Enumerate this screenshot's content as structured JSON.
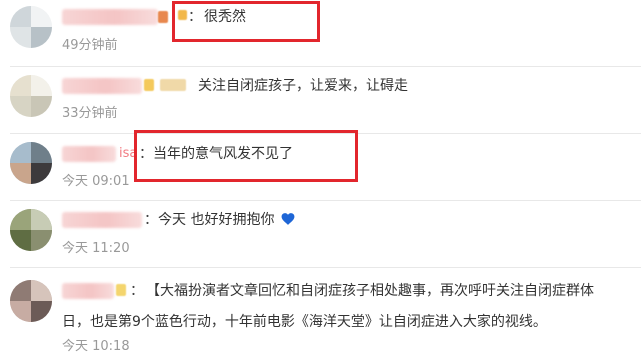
{
  "comments": [
    {
      "name_fragment": "",
      "text": "很秃然",
      "time": "49分钟前"
    },
    {
      "name_fragment": "",
      "text": "关注自闭症孩子，让爱来，让碍走",
      "time": "33分钟前"
    },
    {
      "name_fragment": "isa",
      "text": "当年的意气风发不见了",
      "time": "今天 09:01"
    },
    {
      "name_fragment": "",
      "text": "今天 也好好拥抱你",
      "emoji": "blue-heart-icon",
      "time": "今天 11:20"
    },
    {
      "name_fragment": "",
      "text_line1": "【大福扮演者文章回忆和自闭症孩子相处趣事，再次呼吁关注自闭症群体",
      "text_line2": "日，也是第9个蓝色行动，十年前电影《海洋天堂》让自闭症进入大家的视线。",
      "time": "今天 10:18"
    }
  ],
  "separator": "：",
  "colors": {
    "highlight": "#e2262d",
    "name_pink": "#f17b82",
    "heart": "#1e66d6",
    "time": "#999999"
  }
}
